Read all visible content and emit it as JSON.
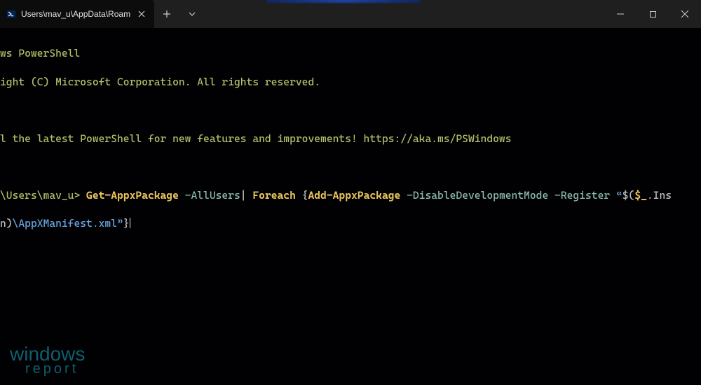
{
  "tab": {
    "title": "Users\\mav_u\\AppData\\Roam"
  },
  "terminal": {
    "line1": "ws PowerShell",
    "line2": "ight (C) Microsoft Corporation. All rights reserved.",
    "line3": "l the latest PowerShell for new features and improvements! https://aka.ms/PSWindows",
    "prompt": "\\Users\\mav_u> ",
    "cmd": {
      "get": "Get-AppxPackage",
      "sw_allusers": " -AllUsers",
      "pipe": "| ",
      "foreach": "Foreach ",
      "brace_open": "{",
      "add": "Add-AppxPackage",
      "sw_ddm": " -DisableDevelopmentMode",
      "sw_reg": " -Register ",
      "str_open": "“",
      "interp_open": "$(",
      "var": "$_",
      "dot_ins": ".Ins",
      "cont_prefix": "n)",
      "path": "\\AppXManifest.xml",
      "str_close": "”",
      "brace_close": "}"
    }
  },
  "watermark": {
    "line1": "windows",
    "line2": "report"
  }
}
